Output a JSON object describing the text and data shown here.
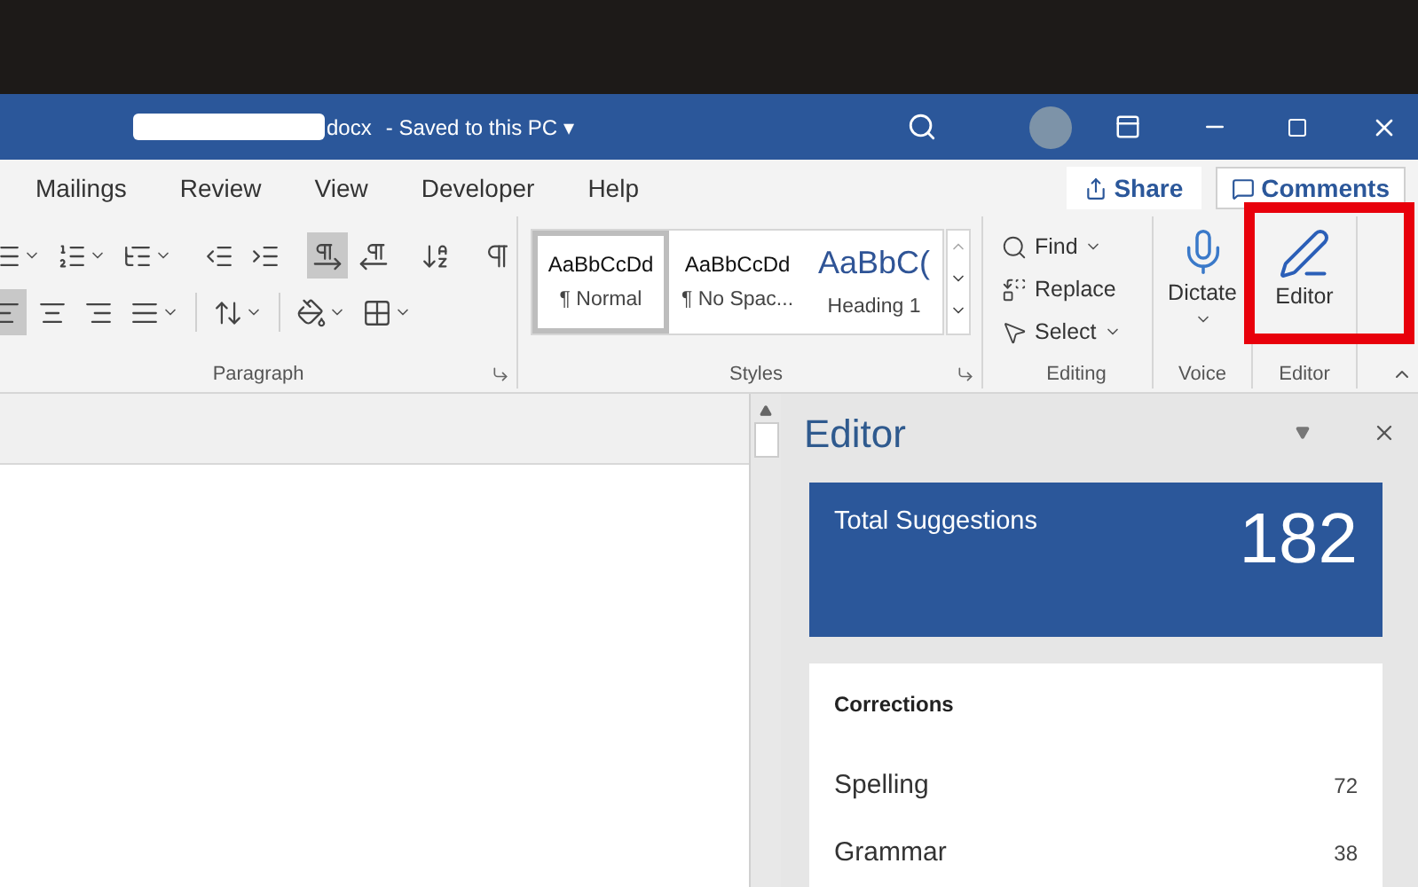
{
  "title_bar": {
    "title": "docx",
    "separator": "-",
    "status": "Saved to this PC",
    "status_caret": "▾"
  },
  "tabs": [
    {
      "label": "Mailings"
    },
    {
      "label": "Review"
    },
    {
      "label": "View"
    },
    {
      "label": "Developer"
    },
    {
      "label": "Help"
    }
  ],
  "share_button": {
    "label": "Share"
  },
  "comments_button": {
    "label": "Comments"
  },
  "paragraph": {
    "label": "Paragraph",
    "row_1": [
      {
        "kind": "bullets",
        "dropdown": true,
        "on": false
      },
      {
        "kind": "numbering",
        "dropdown": true,
        "on": false
      },
      {
        "kind": "multilevel",
        "dropdown": true,
        "on": false
      },
      {
        "kind": "separator"
      },
      {
        "kind": "outdent",
        "dropdown": false,
        "on": false
      },
      {
        "kind": "indent",
        "dropdown": false,
        "on": false
      },
      {
        "kind": "separator"
      },
      {
        "kind": "ltr",
        "dropdown": false,
        "on": true
      },
      {
        "kind": "rtl",
        "dropdown": false,
        "on": false
      },
      {
        "kind": "separator"
      },
      {
        "kind": "sort",
        "dropdown": false,
        "on": false
      },
      {
        "kind": "separator"
      },
      {
        "kind": "pilcrow",
        "dropdown": false,
        "on": false
      }
    ],
    "row_2": [
      {
        "kind": "align_left",
        "dropdown": false,
        "on": true
      },
      {
        "kind": "align_center",
        "dropdown": false,
        "on": false
      },
      {
        "kind": "align_right",
        "dropdown": false,
        "on": false
      },
      {
        "kind": "justify",
        "dropdown": true,
        "on": false
      },
      {
        "kind": "separator"
      },
      {
        "kind": "line_spacing",
        "dropdown": true,
        "on": false
      },
      {
        "kind": "separator"
      },
      {
        "kind": "shading",
        "dropdown": true,
        "on": false
      },
      {
        "kind": "borders",
        "dropdown": true,
        "on": false
      }
    ]
  },
  "styles": {
    "label": "Styles",
    "items": [
      {
        "preview": "AaBbCcDd",
        "name": "¶ Normal",
        "kind": "body",
        "selected": true
      },
      {
        "preview": "AaBbCcDd",
        "name": "¶ No Spac...",
        "kind": "body",
        "selected": false
      },
      {
        "preview": "AaBbC(",
        "name": "Heading 1",
        "kind": "heading",
        "selected": false
      }
    ]
  },
  "editing": {
    "label": "Editing",
    "items": [
      {
        "kind": "find",
        "label": "Find",
        "dropdown": true
      },
      {
        "kind": "replace",
        "label": "Replace",
        "dropdown": false
      },
      {
        "kind": "select",
        "label": "Select",
        "dropdown": true
      }
    ]
  },
  "voice": {
    "label": "Voice",
    "button": "Dictate"
  },
  "editor_group": {
    "label": "Editor",
    "button": "Editor"
  },
  "editor_pane": {
    "title": "Editor",
    "total_label": "Total Suggestions",
    "total": "182",
    "section": "Corrections",
    "rows": [
      {
        "label": "Spelling",
        "count": "72"
      },
      {
        "label": "Grammar",
        "count": "38"
      }
    ]
  }
}
